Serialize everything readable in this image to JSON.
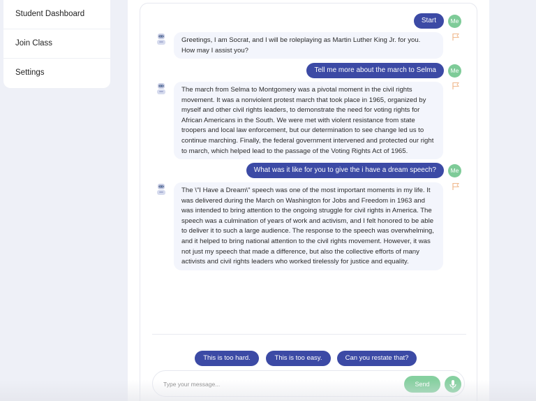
{
  "sidebar": {
    "items": [
      {
        "label": "Student Dashboard"
      },
      {
        "label": "Join Class"
      },
      {
        "label": "Settings"
      }
    ]
  },
  "chat": {
    "avatar_me": "Me",
    "messages": [
      {
        "role": "user",
        "text": "Start"
      },
      {
        "role": "bot",
        "text": "Greetings, I am Socrat, and I will be roleplaying as Martin Luther King Jr. for you. How may I assist you?"
      },
      {
        "role": "user",
        "text": "Tell me more about the march to Selma"
      },
      {
        "role": "bot",
        "text": "The march from Selma to Montgomery was a pivotal moment in the civil rights movement. It was a nonviolent protest march that took place in 1965, organized by myself and other civil rights leaders, to demonstrate the need for voting rights for African Americans in the South. We were met with violent resistance from state troopers and local law enforcement, but our determination to see change led us to continue marching. Finally, the federal government intervened and protected our right to march, which helped lead to the passage of the Voting Rights Act of 1965."
      },
      {
        "role": "user",
        "text": "What was it like for you to give the i have a dream speech?"
      },
      {
        "role": "bot",
        "text": "The \\\"I Have a Dream\\\" speech was one of the most important moments in my life. It was delivered during the March on Washington for Jobs and Freedom in 1963 and was intended to bring attention to the ongoing struggle for civil rights in America. The speech was a culmination of years of work and activism, and I felt honored to be able to deliver it to such a large audience. The response to the speech was overwhelming, and it helped to bring national attention to the civil rights movement. However, it was not just my speech that made a difference, but also the collective efforts of many activists and civil rights leaders who worked tirelessly for justice and equality."
      }
    ]
  },
  "quick_replies": [
    "This is too hard.",
    "This is too easy.",
    "Can you restate that?"
  ],
  "input": {
    "placeholder": "Type your message...",
    "value": "",
    "send_label": "Send"
  },
  "icons": {
    "bot_avatar": "robot-icon",
    "flag": "flag-icon",
    "mic": "microphone-icon"
  },
  "colors": {
    "primary": "#3c4aa5",
    "accent_green": "#86d0a0",
    "flag": "#f0b98e",
    "bot_bubble": "#f3f5fc"
  }
}
